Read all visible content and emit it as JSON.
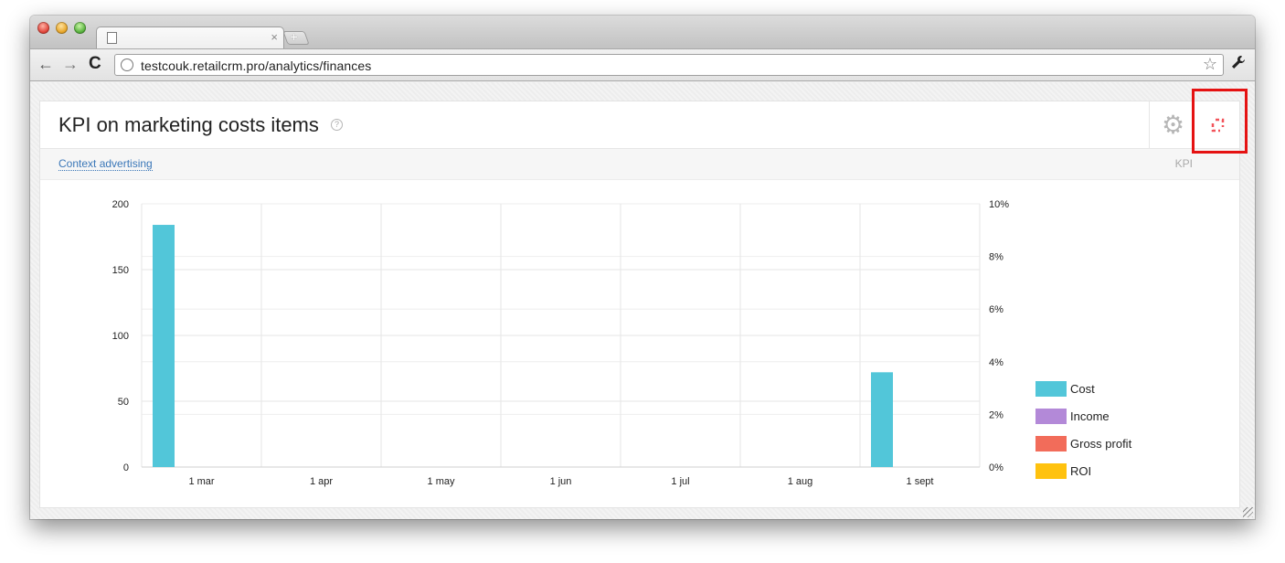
{
  "browser": {
    "tab_title": "",
    "tab_close": "×",
    "new_tab": "+",
    "url": "testcouk.retailcrm.pro/analytics/finances",
    "nav": {
      "back": "←",
      "forward": "→",
      "reload": "C",
      "star": "☆",
      "wrench": "🔧"
    }
  },
  "widget": {
    "title": "KPI on marketing costs items",
    "help": "?",
    "filter_link": "Context advertising",
    "kpi_label": "KPI"
  },
  "colors": {
    "cost": "#52c6d9",
    "income": "#b389d8",
    "gross_profit": "#f26c5a",
    "roi": "#ffc20e",
    "highlight": "#e51212",
    "expand_icon": "#f2545b"
  },
  "icons": {
    "settings": "gear-icon",
    "expand": "expand-icon",
    "help": "help-icon"
  },
  "chart_data": {
    "type": "bar",
    "categories": [
      "1 mar",
      "1 apr",
      "1 may",
      "1 jun",
      "1 jul",
      "1 aug",
      "1 sept"
    ],
    "series": [
      {
        "name": "Cost",
        "values": [
          184,
          0,
          0,
          0,
          0,
          0,
          72
        ]
      },
      {
        "name": "Income",
        "values": [
          0,
          0,
          0,
          0,
          0,
          0,
          0
        ]
      },
      {
        "name": "Gross profit",
        "values": [
          0,
          0,
          0,
          0,
          0,
          0,
          0
        ]
      },
      {
        "name": "ROI",
        "values": [
          0,
          0,
          0,
          0,
          0,
          0,
          0
        ]
      }
    ],
    "y_left": {
      "ticks": [
        "0",
        "50",
        "100",
        "150",
        "200"
      ],
      "ylim": [
        0,
        200
      ]
    },
    "y_right": {
      "ticks": [
        "0%",
        "2%",
        "4%",
        "6%",
        "8%",
        "10%"
      ],
      "ylim": [
        0,
        10
      ]
    },
    "title": "",
    "xlabel": "",
    "ylabel": "",
    "grid": true,
    "legend_position": "right"
  }
}
